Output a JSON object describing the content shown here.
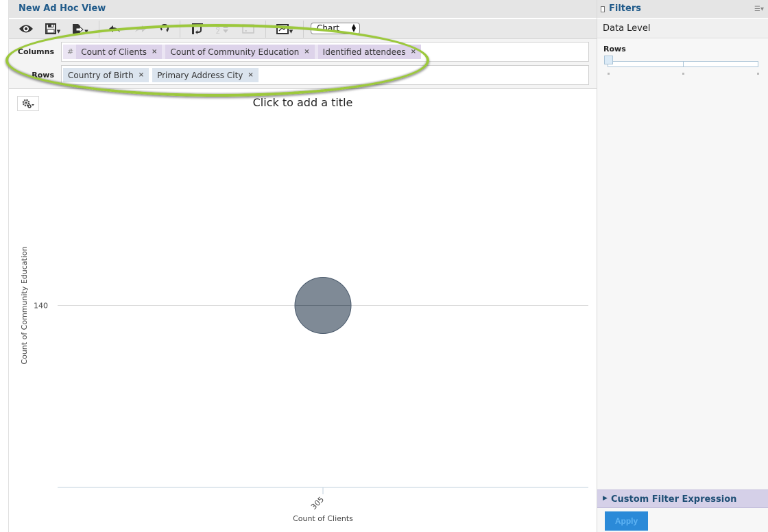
{
  "view": {
    "title": "New Ad Hoc View"
  },
  "toolbar": {
    "buttons": [
      {
        "name": "preview",
        "icon": "eye-icon"
      },
      {
        "name": "save",
        "icon": "save-icon",
        "has_menu": true
      },
      {
        "name": "export",
        "icon": "export-icon",
        "has_menu": true
      },
      {
        "name": "undo",
        "icon": "undo-icon"
      },
      {
        "name": "redo",
        "icon": "redo-icon",
        "disabled": true
      },
      {
        "name": "reset",
        "icon": "reset-icon"
      },
      {
        "name": "pivot",
        "icon": "pivot-icon"
      },
      {
        "name": "sort",
        "icon": "sort-icon",
        "disabled": true
      },
      {
        "name": "options",
        "icon": "options-icon",
        "disabled": true
      },
      {
        "name": "chart-format",
        "icon": "chart-format-icon",
        "has_menu": true
      }
    ],
    "view_type_select": {
      "value": "Chart"
    }
  },
  "layout": {
    "columns_label": "Columns",
    "rows_label": "Rows",
    "measures_symbol": "#",
    "columns": [
      "Count of Clients",
      "Count of Community Education",
      "Identified attendees"
    ],
    "rows": [
      "Country of Birth",
      "Primary Address City"
    ],
    "remove_glyph": "×"
  },
  "chart": {
    "title_placeholder": "Click to add a title",
    "settings_icon": "gear-icon"
  },
  "chart_data": {
    "type": "scatter",
    "subtype": "bubble",
    "title": "",
    "xlabel": "Count of Clients",
    "ylabel": "Count of Community Education",
    "x_ticks": [
      "305"
    ],
    "y_ticks": [
      "140"
    ],
    "points": [
      {
        "x": 305,
        "y": 140,
        "size_measure": "Identified attendees",
        "color": "#7f8a96"
      }
    ],
    "grid": true,
    "legend": "none"
  },
  "filters": {
    "title": "Filters",
    "data_level_label": "Data Level",
    "rows_label": "Rows",
    "data_level_slider": {
      "position": 0,
      "steps": 3
    },
    "custom_filter_label": "Custom Filter Expression",
    "apply_label": "Apply"
  },
  "colors": {
    "title_blue": "#1f5a8a",
    "measure_pill": "#ddd3ea",
    "field_pill": "#dbe4ee",
    "bubble": "#7f8a96",
    "apply_button": "#2b8ad8",
    "annotation_green": "#9cc83c"
  }
}
